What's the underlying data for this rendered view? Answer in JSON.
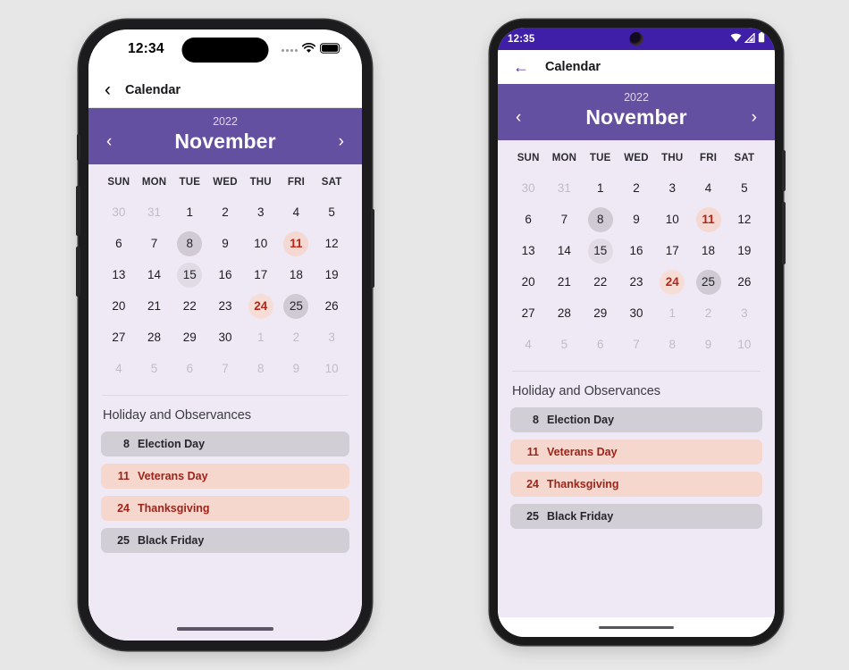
{
  "iphone": {
    "status": {
      "time": "12:34",
      "wifi_icon": "wifi-icon",
      "battery_icon": "battery-full-icon",
      "signal_icon": "signal-dots-icon"
    },
    "nav": {
      "back_icon": "chevron-left-icon",
      "title": "Calendar"
    },
    "month_header": {
      "year": "2022",
      "month": "November",
      "prev_icon": "chevron-left-icon",
      "next_icon": "chevron-right-icon"
    },
    "weekdays": [
      "SUN",
      "MON",
      "TUE",
      "WED",
      "THU",
      "FRI",
      "SAT"
    ],
    "weeks": [
      [
        {
          "n": "30",
          "style": "muted"
        },
        {
          "n": "31",
          "style": "muted"
        },
        {
          "n": "1",
          "style": ""
        },
        {
          "n": "2",
          "style": ""
        },
        {
          "n": "3",
          "style": ""
        },
        {
          "n": "4",
          "style": ""
        },
        {
          "n": "5",
          "style": ""
        }
      ],
      [
        {
          "n": "6",
          "style": ""
        },
        {
          "n": "7",
          "style": ""
        },
        {
          "n": "8",
          "style": "gray"
        },
        {
          "n": "9",
          "style": ""
        },
        {
          "n": "10",
          "style": ""
        },
        {
          "n": "11",
          "style": "red"
        },
        {
          "n": "12",
          "style": ""
        }
      ],
      [
        {
          "n": "13",
          "style": ""
        },
        {
          "n": "14",
          "style": ""
        },
        {
          "n": "15",
          "style": "gray2"
        },
        {
          "n": "16",
          "style": ""
        },
        {
          "n": "17",
          "style": ""
        },
        {
          "n": "18",
          "style": ""
        },
        {
          "n": "19",
          "style": ""
        }
      ],
      [
        {
          "n": "20",
          "style": ""
        },
        {
          "n": "21",
          "style": ""
        },
        {
          "n": "22",
          "style": ""
        },
        {
          "n": "23",
          "style": ""
        },
        {
          "n": "24",
          "style": "red2"
        },
        {
          "n": "25",
          "style": "gray"
        },
        {
          "n": "26",
          "style": ""
        }
      ],
      [
        {
          "n": "27",
          "style": ""
        },
        {
          "n": "28",
          "style": ""
        },
        {
          "n": "29",
          "style": ""
        },
        {
          "n": "30",
          "style": ""
        },
        {
          "n": "1",
          "style": "muted"
        },
        {
          "n": "2",
          "style": "muted"
        },
        {
          "n": "3",
          "style": "muted"
        }
      ],
      [
        {
          "n": "4",
          "style": "muted"
        },
        {
          "n": "5",
          "style": "muted"
        },
        {
          "n": "6",
          "style": "muted"
        },
        {
          "n": "7",
          "style": "muted"
        },
        {
          "n": "8",
          "style": "muted"
        },
        {
          "n": "9",
          "style": "muted"
        },
        {
          "n": "10",
          "style": "muted"
        }
      ]
    ],
    "holidays": {
      "title": "Holiday and Observances",
      "items": [
        {
          "day": "8",
          "label": "Election Day",
          "style": "gray"
        },
        {
          "day": "11",
          "label": "Veterans Day",
          "style": "red"
        },
        {
          "day": "24",
          "label": "Thanksgiving",
          "style": "red"
        },
        {
          "day": "25",
          "label": "Black Friday",
          "style": "gray"
        }
      ]
    }
  },
  "android": {
    "status": {
      "time": "12:35",
      "wifi_icon": "wifi-icon",
      "signal_icon": "signal-bars-icon",
      "battery_icon": "battery-full-icon"
    },
    "nav": {
      "back_icon": "arrow-left-icon",
      "title": "Calendar"
    },
    "month_header": {
      "year": "2022",
      "month": "November",
      "prev_icon": "chevron-left-icon",
      "next_icon": "chevron-right-icon"
    },
    "weekdays": [
      "SUN",
      "MON",
      "TUE",
      "WED",
      "THU",
      "FRI",
      "SAT"
    ],
    "weeks": [
      [
        {
          "n": "30",
          "style": "muted"
        },
        {
          "n": "31",
          "style": "muted"
        },
        {
          "n": "1",
          "style": ""
        },
        {
          "n": "2",
          "style": ""
        },
        {
          "n": "3",
          "style": ""
        },
        {
          "n": "4",
          "style": ""
        },
        {
          "n": "5",
          "style": ""
        }
      ],
      [
        {
          "n": "6",
          "style": ""
        },
        {
          "n": "7",
          "style": ""
        },
        {
          "n": "8",
          "style": "gray"
        },
        {
          "n": "9",
          "style": ""
        },
        {
          "n": "10",
          "style": ""
        },
        {
          "n": "11",
          "style": "red"
        },
        {
          "n": "12",
          "style": ""
        }
      ],
      [
        {
          "n": "13",
          "style": ""
        },
        {
          "n": "14",
          "style": ""
        },
        {
          "n": "15",
          "style": "gray2"
        },
        {
          "n": "16",
          "style": ""
        },
        {
          "n": "17",
          "style": ""
        },
        {
          "n": "18",
          "style": ""
        },
        {
          "n": "19",
          "style": ""
        }
      ],
      [
        {
          "n": "20",
          "style": ""
        },
        {
          "n": "21",
          "style": ""
        },
        {
          "n": "22",
          "style": ""
        },
        {
          "n": "23",
          "style": ""
        },
        {
          "n": "24",
          "style": "red2"
        },
        {
          "n": "25",
          "style": "gray"
        },
        {
          "n": "26",
          "style": ""
        }
      ],
      [
        {
          "n": "27",
          "style": ""
        },
        {
          "n": "28",
          "style": ""
        },
        {
          "n": "29",
          "style": ""
        },
        {
          "n": "30",
          "style": ""
        },
        {
          "n": "1",
          "style": "muted"
        },
        {
          "n": "2",
          "style": "muted"
        },
        {
          "n": "3",
          "style": "muted"
        }
      ],
      [
        {
          "n": "4",
          "style": "muted"
        },
        {
          "n": "5",
          "style": "muted"
        },
        {
          "n": "6",
          "style": "muted"
        },
        {
          "n": "7",
          "style": "muted"
        },
        {
          "n": "8",
          "style": "muted"
        },
        {
          "n": "9",
          "style": "muted"
        },
        {
          "n": "10",
          "style": "muted"
        }
      ]
    ],
    "holidays": {
      "title": "Holiday and Observances",
      "items": [
        {
          "day": "8",
          "label": "Election Day",
          "style": "gray"
        },
        {
          "day": "11",
          "label": "Veterans Day",
          "style": "red"
        },
        {
          "day": "24",
          "label": "Thanksgiving",
          "style": "red"
        },
        {
          "day": "25",
          "label": "Black Friday",
          "style": "gray"
        }
      ]
    }
  },
  "colors": {
    "page_background": "#e7e7e7",
    "month_header_purple": "#6450a0",
    "android_statusbar_purple": "#3f1fa8",
    "calendar_background": "#efe8f5",
    "holiday_gray": "#d2ced6",
    "holiday_red": "#f5d7ce",
    "holiday_red_text": "#9e2318",
    "day_gray_circle": "#cfcad4",
    "day_red_circle": "#f4d8d1"
  }
}
